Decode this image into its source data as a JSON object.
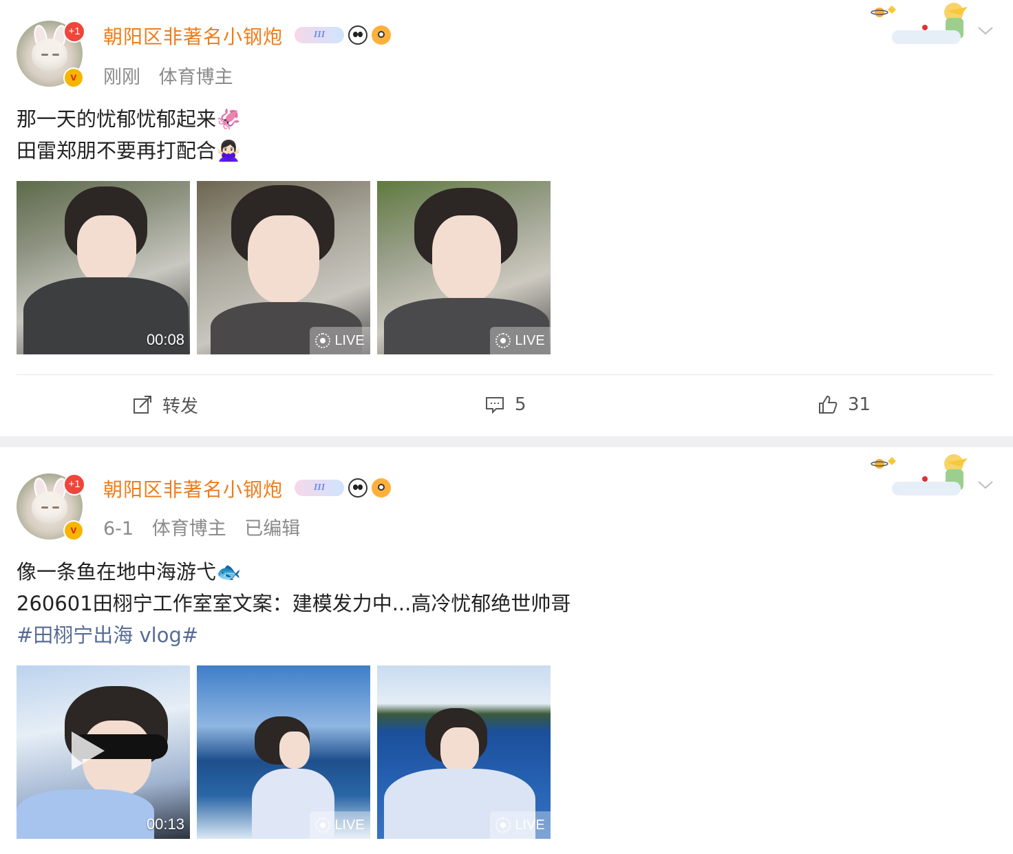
{
  "colors": {
    "username": "#ee7c1a",
    "hashtag": "#576b95",
    "meta": "#8a8a8a",
    "separator": "#efeff1"
  },
  "posts": [
    {
      "username": "朝阳区非著名小钢炮",
      "avatar_badge": "+1",
      "verified_badge": "v",
      "vip_badge": "III",
      "meta": {
        "time": "刚刚",
        "role": "体育博主",
        "edited": ""
      },
      "lines": [
        "那一天的忧郁忧郁起来🦑",
        "田雷郑朋不要再打配合🙅🏻‍♀️"
      ],
      "hashtag": "",
      "media": [
        {
          "type": "video",
          "duration": "00:08"
        },
        {
          "type": "live",
          "label": "LIVE"
        },
        {
          "type": "live",
          "label": "LIVE"
        }
      ],
      "actions": {
        "repost": "转发",
        "comments": "5",
        "likes": "31"
      }
    },
    {
      "username": "朝阳区非著名小钢炮",
      "avatar_badge": "+1",
      "verified_badge": "v",
      "vip_badge": "III",
      "meta": {
        "time": "6-1",
        "role": "体育博主",
        "edited": "已编辑"
      },
      "lines": [
        "像一条鱼在地中海游弋🐟",
        "260601田栩宁工作室室文案：建模发力中...高冷忧郁绝世帅哥"
      ],
      "hashtag": "#田栩宁出海 vlog#",
      "media": [
        {
          "type": "video",
          "duration": "00:13"
        },
        {
          "type": "live",
          "label": "LIVE"
        },
        {
          "type": "live",
          "label": "LIVE"
        }
      ]
    }
  ],
  "icons": [
    "more-chevron-icon",
    "repost-icon",
    "comment-icon",
    "like-icon",
    "live-photo-icon",
    "play-icon"
  ]
}
